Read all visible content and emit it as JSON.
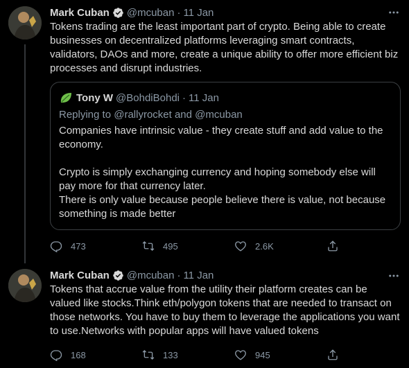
{
  "tweets": [
    {
      "author_name": "Mark Cuban",
      "handle": "@mcuban",
      "separator": "·",
      "time": "11 Jan",
      "text": "Tokens trading are the least important part of crypto. Being able to create businesses on decentralized platforms leveraging smart contracts, validators, DAOs and more, create a unique ability to offer more efficient biz processes and disrupt industries.",
      "quote": {
        "author_name": "Tony W",
        "handle": "@BohdiBohdi",
        "separator": "·",
        "time": "11 Jan",
        "replying_prefix": "Replying to",
        "replying_user1": "@rallyrocket",
        "replying_and": "and",
        "replying_user2": "@mcuban",
        "paragraph1": "Companies have intrinsic value - they create stuff and add value to the economy.",
        "paragraph2a": "Crypto is simply exchanging currency and hoping somebody else will pay more for that currency later.",
        "paragraph2b": "There is only value because people believe there is value, not because something is made better"
      },
      "replies": "473",
      "retweets": "495",
      "likes": "2.6K"
    },
    {
      "author_name": "Mark Cuban",
      "handle": "@mcuban",
      "separator": "·",
      "time": "11 Jan",
      "text": "Tokens that accrue value from the utility their platform creates can be valued like stocks.Think eth/polygon tokens that are needed to transact on those networks. You have to buy them to leverage the applications you want to use.Networks with popular apps will have valued tokens",
      "replies": "168",
      "retweets": "133",
      "likes": "945"
    }
  ],
  "icons": {
    "verified": "verified-badge-icon",
    "more": "more-icon",
    "reply": "reply-icon",
    "retweet": "retweet-icon",
    "like": "like-icon",
    "share": "share-icon"
  },
  "colors": {
    "background": "#000000",
    "text": "#d9d9d9",
    "secondary": "#8b98a5",
    "border": "#3c4043",
    "verified": "#d9d9d9"
  }
}
